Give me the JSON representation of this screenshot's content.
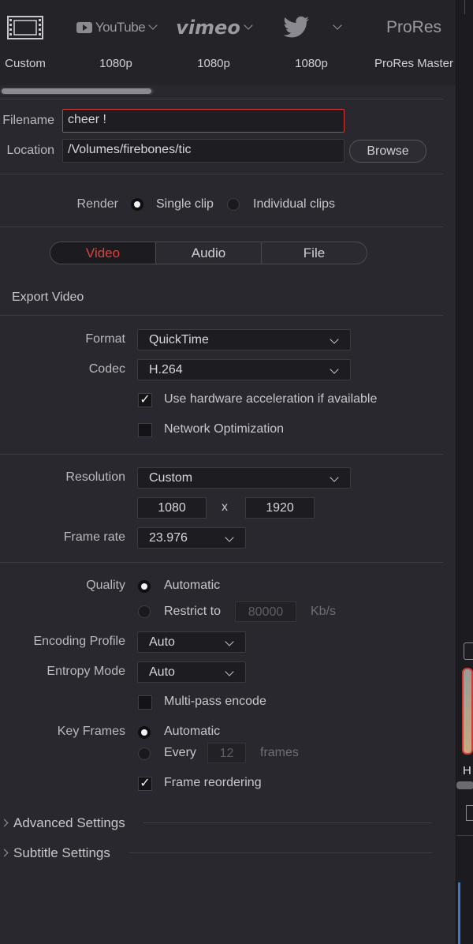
{
  "presets": [
    {
      "name": "custom",
      "logo": "film-icon",
      "label": "Custom"
    },
    {
      "name": "youtube",
      "logo": "YouTube",
      "label": "1080p"
    },
    {
      "name": "vimeo",
      "logo": "vimeo",
      "label": "1080p"
    },
    {
      "name": "twitter",
      "logo": "twitter-bird-icon",
      "label": "1080p"
    },
    {
      "name": "prores",
      "logo": "ProRes",
      "label": "ProRes Master"
    }
  ],
  "filename": {
    "label": "Filename",
    "value": "cheer !"
  },
  "location": {
    "label": "Location",
    "value": "/Volumes/firebones/tic",
    "browse": "Browse"
  },
  "render": {
    "label": "Render",
    "single": "Single clip",
    "individual": "Individual clips",
    "selected": "single"
  },
  "tabs": [
    {
      "label": "Video",
      "active": true
    },
    {
      "label": "Audio",
      "active": false
    },
    {
      "label": "File",
      "active": false
    }
  ],
  "export_video": "Export Video",
  "format": {
    "label": "Format",
    "value": "QuickTime"
  },
  "codec": {
    "label": "Codec",
    "value": "H.264"
  },
  "hw_accel": {
    "label": "Use hardware acceleration if available",
    "checked": true
  },
  "network_opt": {
    "label": "Network Optimization",
    "checked": false
  },
  "resolution": {
    "label": "Resolution",
    "value": "Custom",
    "width": "1080",
    "x": "x",
    "height": "1920"
  },
  "frame_rate": {
    "label": "Frame rate",
    "value": "23.976"
  },
  "quality": {
    "label": "Quality",
    "automatic": "Automatic",
    "restrict": "Restrict to",
    "restrict_value": "80000",
    "unit": "Kb/s"
  },
  "encoding_profile": {
    "label": "Encoding Profile",
    "value": "Auto"
  },
  "entropy_mode": {
    "label": "Entropy Mode",
    "value": "Auto"
  },
  "multipass": {
    "label": "Multi-pass encode",
    "checked": false
  },
  "key_frames": {
    "label": "Key Frames",
    "automatic": "Automatic",
    "every": "Every",
    "every_value": "12",
    "unit": "frames"
  },
  "frame_reordering": {
    "label": "Frame reordering",
    "checked": true
  },
  "advanced": "Advanced Settings",
  "subtitle": "Subtitle Settings",
  "colors": {
    "accent_red": "#e0403a",
    "panel": "#28282e",
    "field": "#1e1e22"
  }
}
